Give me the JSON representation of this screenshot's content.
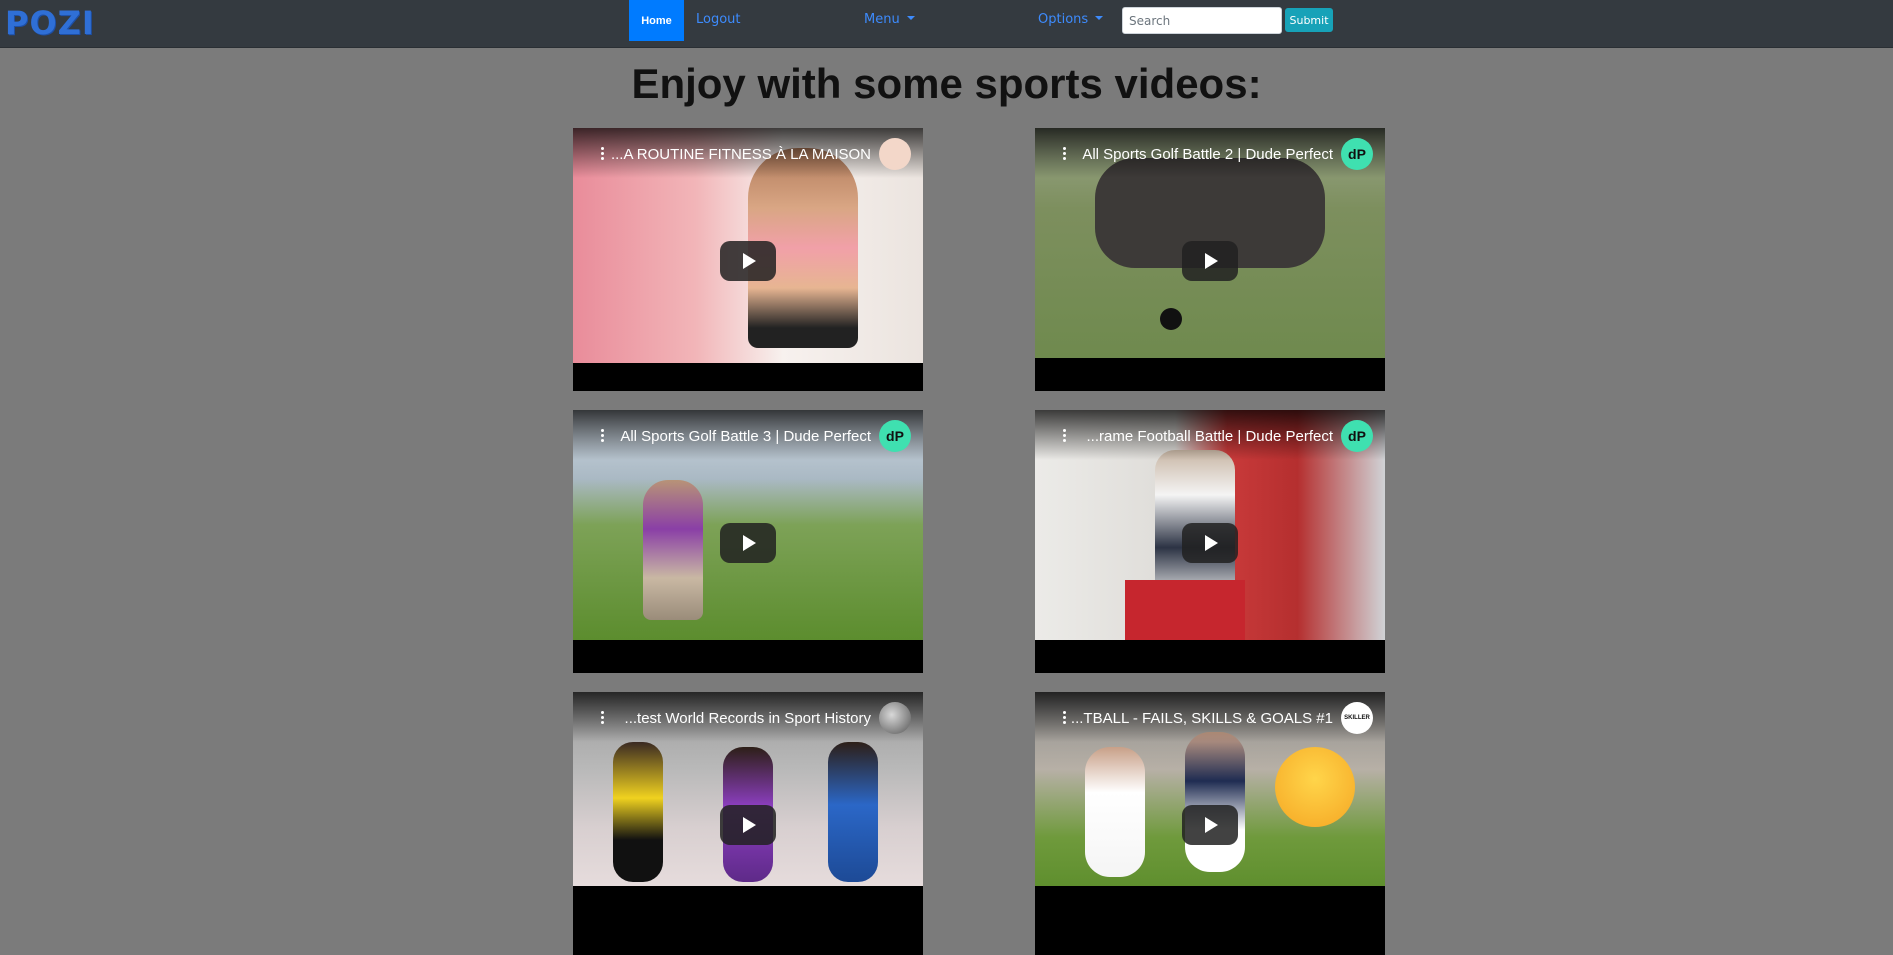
{
  "brand": "POZI",
  "nav": {
    "home": "Home",
    "logout": "Logout",
    "menu": "Menu",
    "options": "Options",
    "search_placeholder": "Search",
    "submit": "Submit"
  },
  "page_title": "Enjoy with some sports videos:",
  "videos": [
    {
      "title": "...A ROUTINE FITNESS À LA MAISON",
      "avatar": "",
      "avatar_color": "#f3d7c9"
    },
    {
      "title": "All Sports Golf Battle 2 | Dude Perfect",
      "avatar": "dP",
      "avatar_color": "#3fe0b0"
    },
    {
      "title": "All Sports Golf Battle 3 | Dude Perfect",
      "avatar": "dP",
      "avatar_color": "#3fe0b0"
    },
    {
      "title": "...rame Football Battle | Dude Perfect",
      "avatar": "dP",
      "avatar_color": "#3fe0b0"
    },
    {
      "title": "...test World Records in Sport History",
      "avatar": "",
      "avatar_color": "#9a9a9a"
    },
    {
      "title": "...TBALL - FAILS, SKILLS & GOALS #1",
      "avatar": "SKILLER",
      "avatar_color": "#ffffff"
    }
  ],
  "colors": {
    "navbar": "#343a40",
    "background": "#7b7b7b",
    "primary": "#007bff",
    "info": "#17a2b8",
    "brand": "#2f6fd6"
  }
}
